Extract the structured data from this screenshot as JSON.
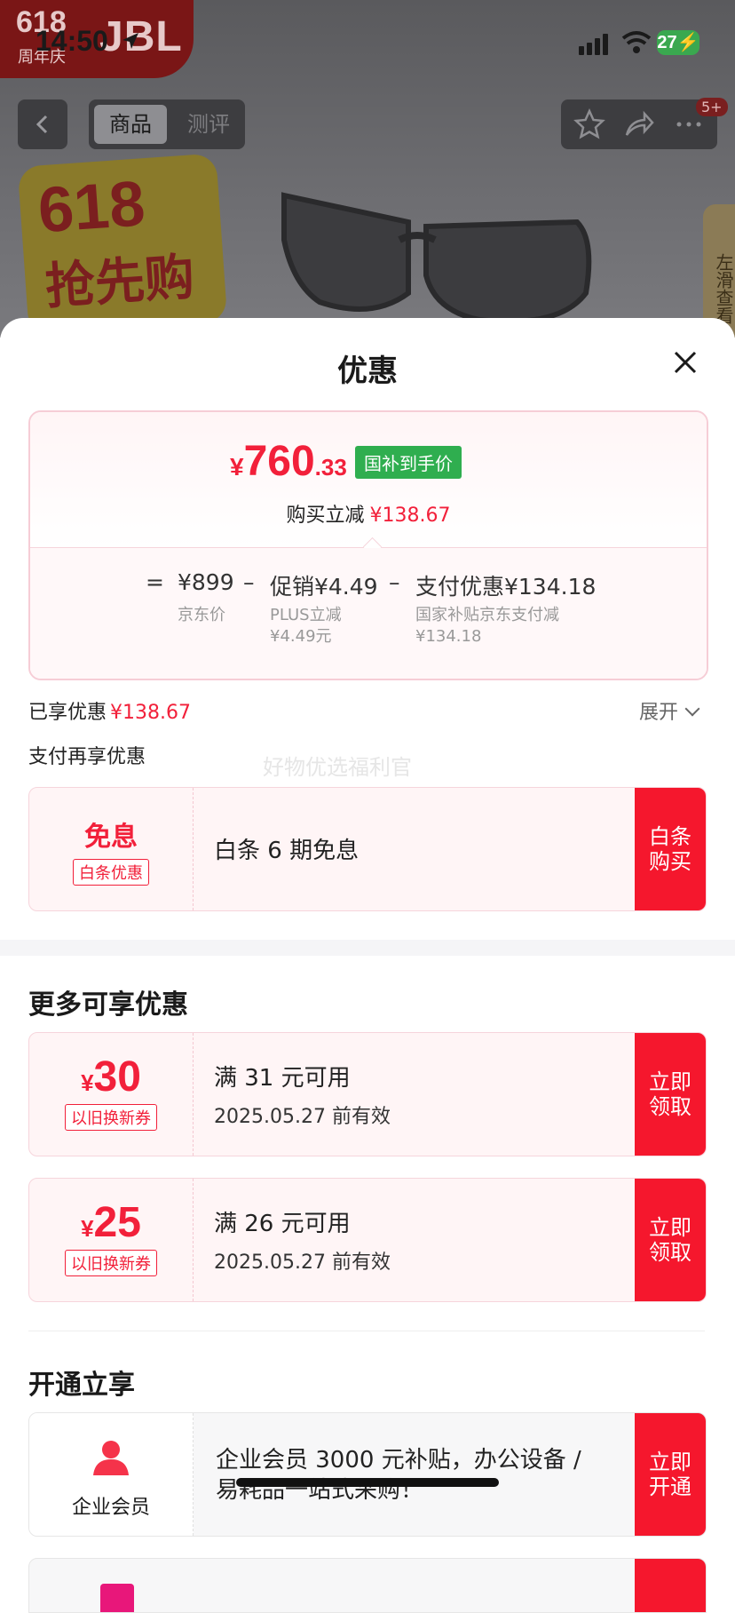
{
  "status_bar": {
    "time": "14:50",
    "battery": "27"
  },
  "brand": {
    "event": "618",
    "event_sub": "周年庆",
    "name": "JBL"
  },
  "nav": {
    "tab_goods": "商品",
    "tab_review": "测评",
    "badge": "5+"
  },
  "promo": {
    "line1": "618",
    "line2": "抢先购"
  },
  "side_hint": "左滑查看",
  "sheet": {
    "title": "优惠"
  },
  "price": {
    "yen": "¥",
    "integer": "760",
    "decimal": ".33",
    "tag": "国补到手价",
    "reduce_label": "购买立减",
    "reduce_value": "¥138.67"
  },
  "breakdown": {
    "equals": "=",
    "base_value": "¥899",
    "base_label": "京东价",
    "minus1": "–",
    "promo_value": "促销¥4.49",
    "promo_sub1": "PLUS立减",
    "promo_sub2": "¥4.49元",
    "minus2": "–",
    "pay_value": "支付优惠¥134.18",
    "pay_sub1": "国家补贴京东支付减",
    "pay_sub2": "¥134.18"
  },
  "enjoyed": {
    "label": "已享优惠",
    "value": "¥138.67",
    "expand": "展开"
  },
  "pay_section": {
    "title": "支付再享优惠",
    "watermark": "好物优选福利官"
  },
  "baitiao": {
    "main": "免息",
    "tag": "白条优惠",
    "text": "白条 6 期免息",
    "button": "白条购买"
  },
  "more_title": "更多可享优惠",
  "coupons": [
    {
      "yen": "¥",
      "amount": "30",
      "tag": "以旧换新券",
      "condition": "满 31 元可用",
      "valid": "2025.05.27 前有效",
      "button": "立即领取"
    },
    {
      "yen": "¥",
      "amount": "25",
      "tag": "以旧换新券",
      "condition": "满 26 元可用",
      "valid": "2025.05.27 前有效",
      "button": "立即领取"
    }
  ],
  "open_title": "开通立享",
  "member": {
    "label": "企业会员",
    "text": "企业会员 3000 元补贴，办公设备 / 易耗品一站式采购！",
    "button": "立即开通"
  },
  "colors": {
    "accent": "#f2203a",
    "button": "#f5172d",
    "tag_green": "#2fae4f"
  }
}
